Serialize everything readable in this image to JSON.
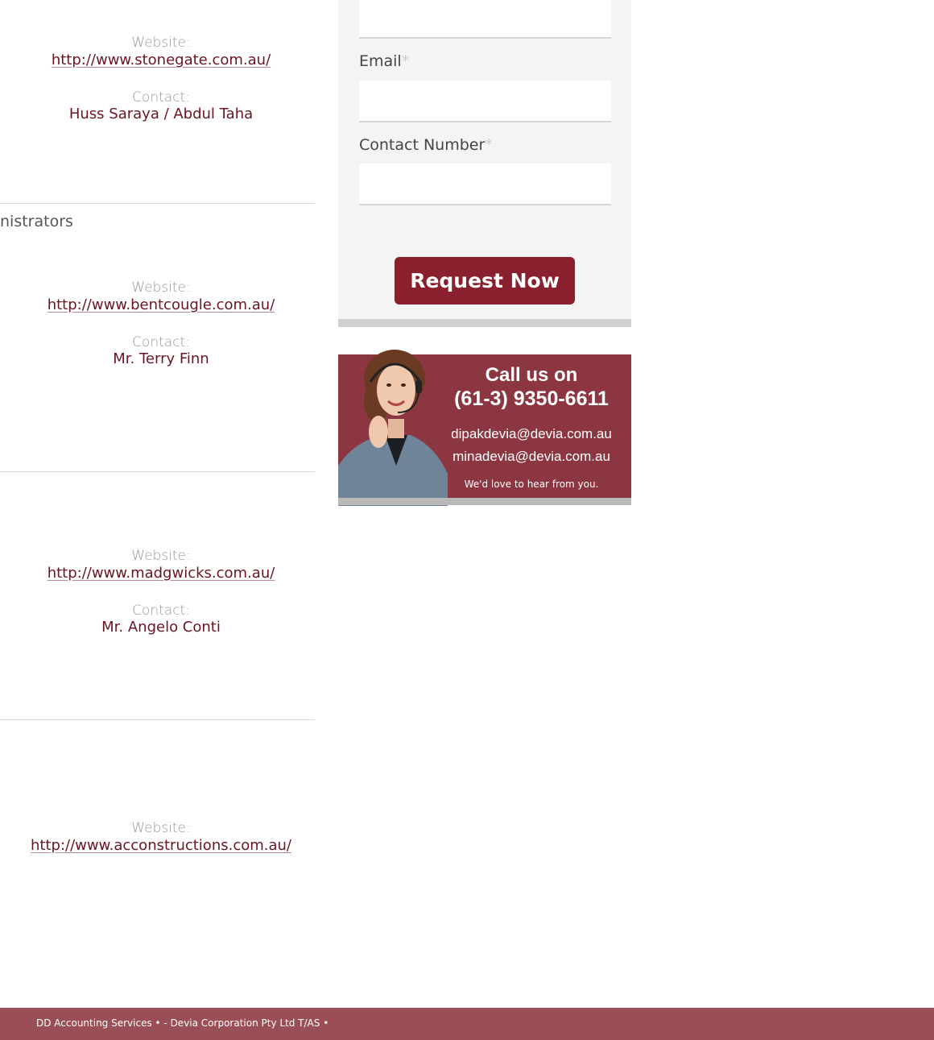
{
  "listings": [
    {
      "website_label": "Website:",
      "website_url": "http://www.stonegate.com.au/",
      "contact_label": "Contact:",
      "contact_name": "Huss Saraya / Abdul Taha"
    },
    {
      "heading_fragment": "nistrators",
      "website_label": "Website:",
      "website_url": "http://www.bentcougle.com.au/",
      "contact_label": "Contact:",
      "contact_name": "Mr. Terry Finn"
    },
    {
      "website_label": "Website:",
      "website_url": "http://www.madgwicks.com.au/",
      "contact_label": "Contact:",
      "contact_name": "Mr. Angelo Conti"
    },
    {
      "website_label": "Website:",
      "website_url": "http://www.acconstructions.com.au/"
    }
  ],
  "form": {
    "email_label": "Email",
    "contact_number_label": "Contact Number",
    "required_mark": "*",
    "submit_label": "Request Now"
  },
  "banner": {
    "line1": "Call us on",
    "phone": "(61-3) 9350-6611",
    "email1": "dipakdevia@devia.com.au",
    "email2": "minadevia@devia.com.au",
    "tagline": "We'd love to hear from you."
  },
  "footer": {
    "text": "DD Accounting Services • - Devia Corporation Pty Ltd T/AS •"
  },
  "colors": {
    "accent": "#8a1f2d",
    "link": "#6b1522",
    "banner": "#8b3641",
    "footer": "#9a4e56"
  }
}
